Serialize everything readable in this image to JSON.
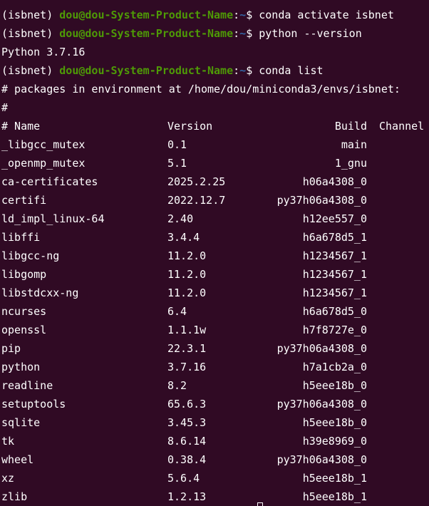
{
  "prompt_env": "(isbnet)",
  "prompt_user": "dou@dou-System-Product-Name",
  "prompt_path": "~",
  "prompt_sep": ":",
  "prompt_dollar": "$",
  "commands": [
    "conda activate isbnet",
    "python --version",
    "conda list"
  ],
  "python_version_output": "Python 3.7.16",
  "list_header_line": "# packages in environment at /home/dou/miniconda3/envs/isbnet:",
  "list_hash_line": "#",
  "columns": {
    "name": "# Name",
    "version": "Version",
    "build": "Build",
    "channel": "Channel"
  },
  "packages": [
    {
      "name": "_libgcc_mutex",
      "version": "0.1",
      "build": "main"
    },
    {
      "name": "_openmp_mutex",
      "version": "5.1",
      "build": "1_gnu"
    },
    {
      "name": "ca-certificates",
      "version": "2025.2.25",
      "build": "h06a4308_0"
    },
    {
      "name": "certifi",
      "version": "2022.12.7",
      "build": "py37h06a4308_0"
    },
    {
      "name": "ld_impl_linux-64",
      "version": "2.40",
      "build": "h12ee557_0"
    },
    {
      "name": "libffi",
      "version": "3.4.4",
      "build": "h6a678d5_1"
    },
    {
      "name": "libgcc-ng",
      "version": "11.2.0",
      "build": "h1234567_1"
    },
    {
      "name": "libgomp",
      "version": "11.2.0",
      "build": "h1234567_1"
    },
    {
      "name": "libstdcxx-ng",
      "version": "11.2.0",
      "build": "h1234567_1"
    },
    {
      "name": "ncurses",
      "version": "6.4",
      "build": "h6a678d5_0"
    },
    {
      "name": "openssl",
      "version": "1.1.1w",
      "build": "h7f8727e_0"
    },
    {
      "name": "pip",
      "version": "22.3.1",
      "build": "py37h06a4308_0"
    },
    {
      "name": "python",
      "version": "3.7.16",
      "build": "h7a1cb2a_0"
    },
    {
      "name": "readline",
      "version": "8.2",
      "build": "h5eee18b_0"
    },
    {
      "name": "setuptools",
      "version": "65.6.3",
      "build": "py37h06a4308_0"
    },
    {
      "name": "sqlite",
      "version": "3.45.3",
      "build": "h5eee18b_0"
    },
    {
      "name": "tk",
      "version": "8.6.14",
      "build": "h39e8969_0"
    },
    {
      "name": "wheel",
      "version": "0.38.4",
      "build": "py37h06a4308_0"
    },
    {
      "name": "xz",
      "version": "5.6.4",
      "build": "h5eee18b_1"
    },
    {
      "name": "zlib",
      "version": "1.2.13",
      "build": "h5eee18b_1"
    }
  ],
  "colors": {
    "background": "#300a24",
    "user": "#4e9a06",
    "path": "#3465a4",
    "text": "#ffffff"
  }
}
